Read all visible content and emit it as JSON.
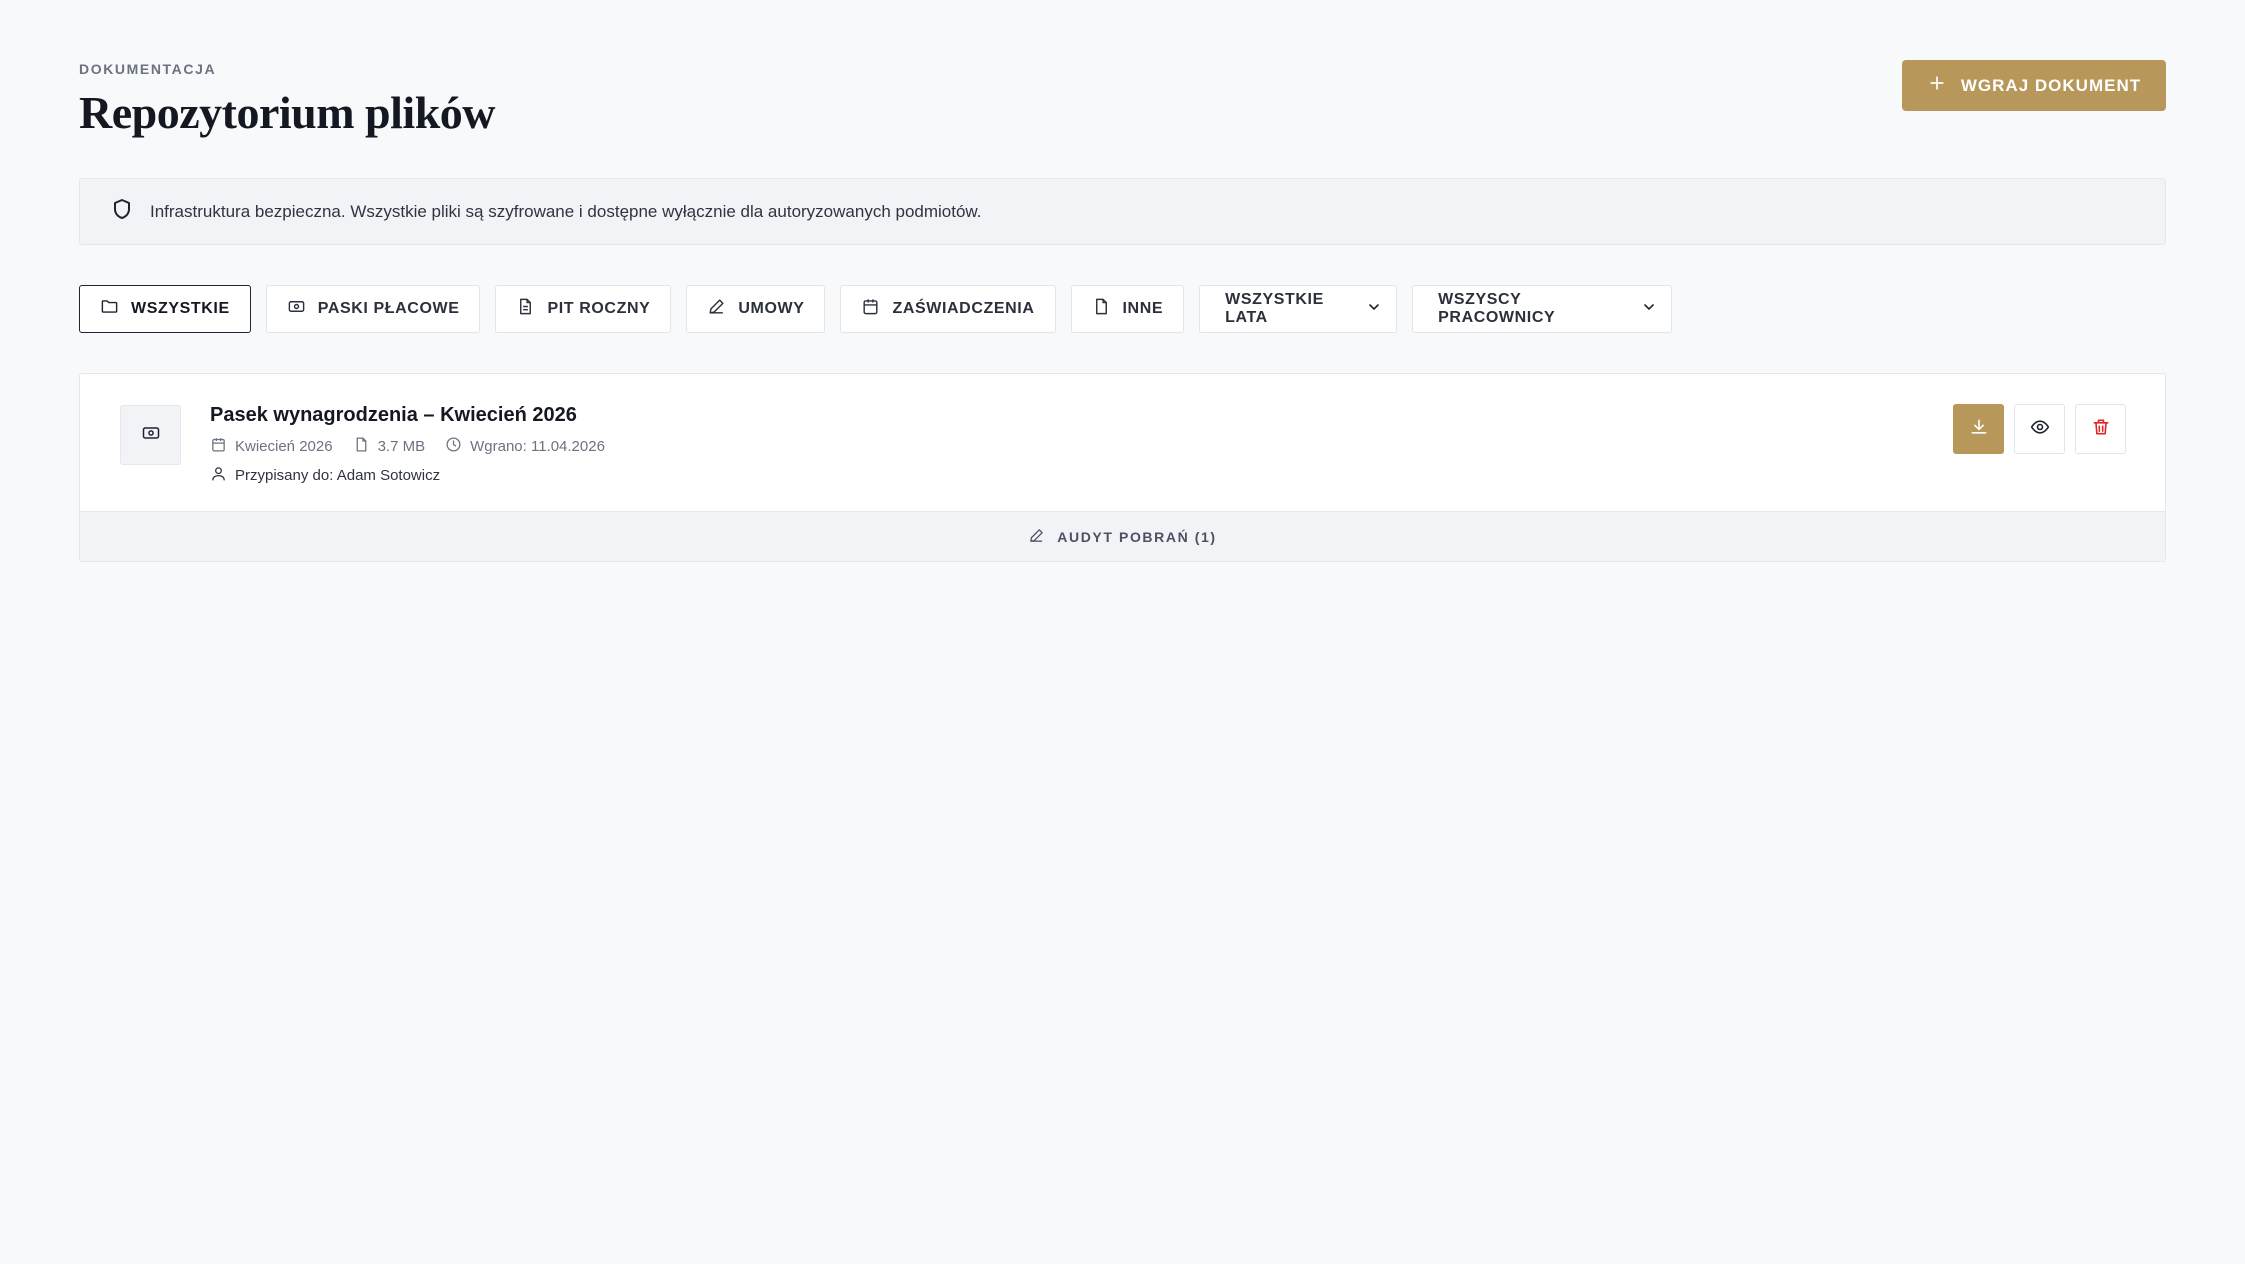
{
  "header": {
    "eyebrow": "DOKUMENTACJA",
    "title": "Repozytorium plików",
    "upload_label": "WGRAJ DOKUMENT"
  },
  "notice": {
    "icon": "shield-icon",
    "text": "Infrastruktura bezpieczna. Wszystkie pliki są szyfrowane i dostępne wyłącznie dla autoryzowanych podmiotów."
  },
  "filters": {
    "tabs": [
      {
        "label": "WSZYSTKIE",
        "icon": "folder-icon",
        "active": true
      },
      {
        "label": "PASKI PŁACOWE",
        "icon": "banknote-icon",
        "active": false
      },
      {
        "label": "PIT ROCZNY",
        "icon": "file-text-icon",
        "active": false
      },
      {
        "label": "UMOWY",
        "icon": "pen-icon",
        "active": false
      },
      {
        "label": "ZAŚWIADCZENIA",
        "icon": "calendar-icon",
        "active": false
      },
      {
        "label": "INNE",
        "icon": "file-icon",
        "active": false
      }
    ],
    "year_select": "WSZYSTKIE LATA",
    "employee_select": "WSZYSCY PRACOWNICY"
  },
  "documents": [
    {
      "title": "Pasek wynagrodzenia – Kwiecień 2026",
      "period": "Kwiecień 2026",
      "size": "3.7 MB",
      "uploaded": "Wgrano: 11.04.2026",
      "assigned": "Przypisany do: Adam Sotowicz",
      "audit_label": "AUDYT POBRAŃ (1)"
    }
  ],
  "colors": {
    "accent": "#b8975a",
    "background": "#f8f9fb",
    "danger": "#dc2626"
  }
}
